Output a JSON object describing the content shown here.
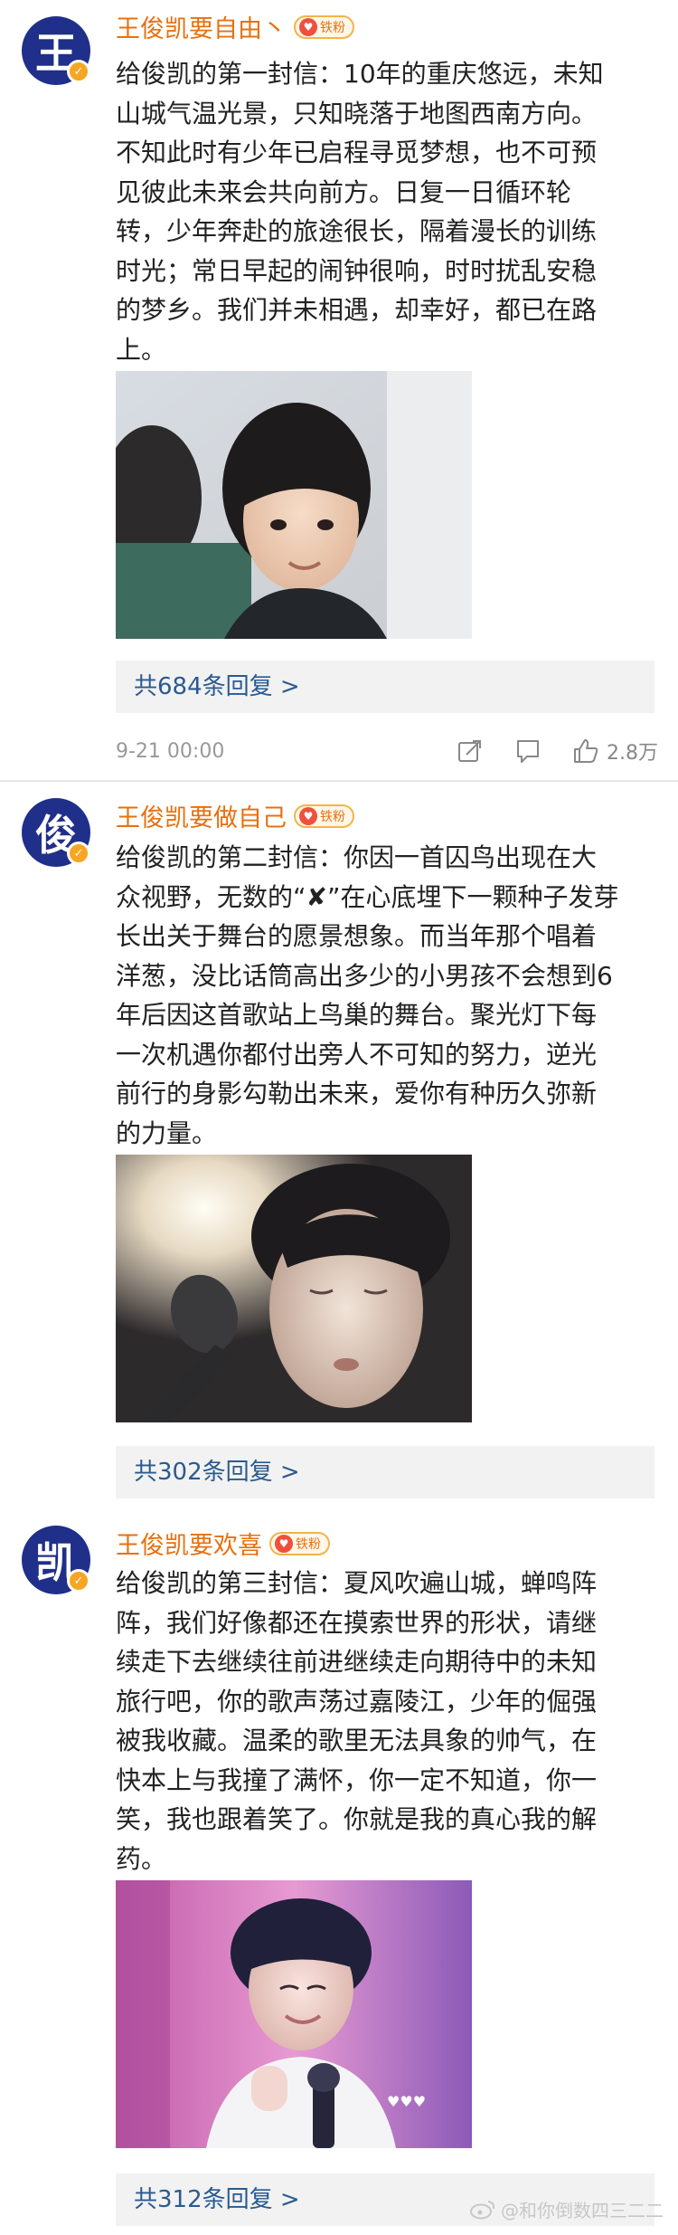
{
  "posts": [
    {
      "avatar_char": "王",
      "username": "王俊凯要自由丶",
      "fan_badge": "铁粉",
      "content": "给俊凯的第一封信：10年的重庆悠远，未知\n山城气温光景，只知晓落于地图西南方向。\n不知此时有少年已启程寻觅梦想，也不可预\n见彼此未来会共向前方。日复一日循环轮\n转，少年奔赴的旅途很长，隔着漫长的训练\n时光；常日早起的闹钟很响，时时扰乱安稳\n的梦乡。我们并未相遇，却幸好，都已在路\n上。",
      "replies": "共684条回复 >",
      "time": "9-21 00:00",
      "likes": "2.8万"
    },
    {
      "avatar_char": "俊",
      "username": "王俊凯要做自己",
      "fan_badge": "铁粉",
      "content": "给俊凯的第二封信：你因一首囚鸟出现在大\n众视野，无数的“✘”在心底埋下一颗种子发芽\n长出关于舞台的愿景想象。而当年那个唱着\n洋葱，没比话筒高出多少的小男孩不会想到6\n年后因这首歌站上鸟巢的舞台。聚光灯下每\n一次机遇你都付出旁人不可知的努力，逆光\n前行的身影勾勒出未来，爱你有种历久弥新\n的力量。",
      "replies": "共302条回复 >"
    },
    {
      "avatar_char": "凯",
      "username": "王俊凯要欢喜",
      "fan_badge": "铁粉",
      "content": "给俊凯的第三封信：夏风吹遍山城，蝉鸣阵\n阵，我们好像都还在摸索世界的形状，请继\n续走下去继续往前进继续走向期待中的未知\n旅行吧，你的歌声荡过嘉陵江，少年的倔强\n被我收藏。温柔的歌里无法具象的帅气，在\n快本上与我撞了满怀，你一定不知道，你一\n笑，我也跟着笑了。你就是我的真心我的解\n药。",
      "replies": "共312条回复 >"
    }
  ],
  "watermark": "@和你倒数四三二二",
  "colors": {
    "username": "#e8700c",
    "reply_link": "#2a5a90",
    "avatar_bg": "#1f2f8a"
  },
  "icons": {
    "share": "share-icon",
    "comment": "comment-icon",
    "like": "thumbs-up-icon",
    "weibo": "weibo-logo-icon"
  }
}
